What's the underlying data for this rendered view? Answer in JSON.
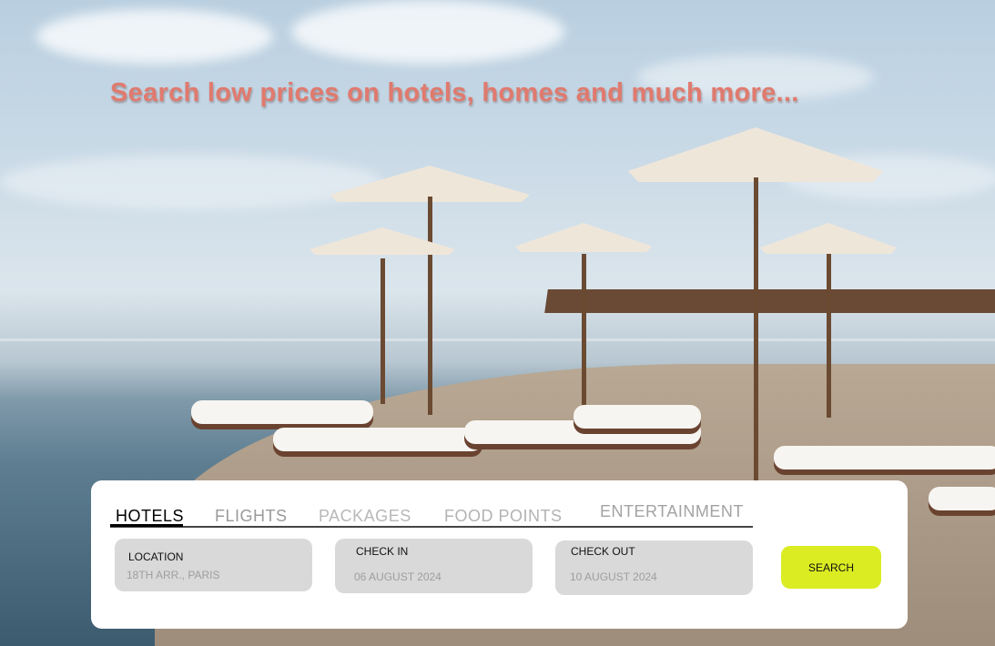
{
  "headline": "Search low prices on hotels, homes and much more...",
  "tabs": [
    {
      "label": "HOTELS",
      "active": true
    },
    {
      "label": "FLIGHTS",
      "active": false
    },
    {
      "label": "PACKAGES",
      "active": false
    },
    {
      "label": "FOOD POINTS",
      "active": false
    },
    {
      "label": "ENTERTAINMENT",
      "active": false
    }
  ],
  "fields": {
    "location": {
      "label": "LOCATION",
      "value": "18TH ARR., PARIS"
    },
    "check_in": {
      "label": "CHECK IN",
      "value": "06 AUGUST 2024"
    },
    "check_out": {
      "label": "CHECK OUT",
      "value": "10 AUGUST 2024"
    }
  },
  "search_button": {
    "label": "SEARCH"
  },
  "colors": {
    "headline": "#e07a6e",
    "panel": "#ffffff",
    "field_bg": "#d9d9d9",
    "search_button": "#dbec23"
  }
}
